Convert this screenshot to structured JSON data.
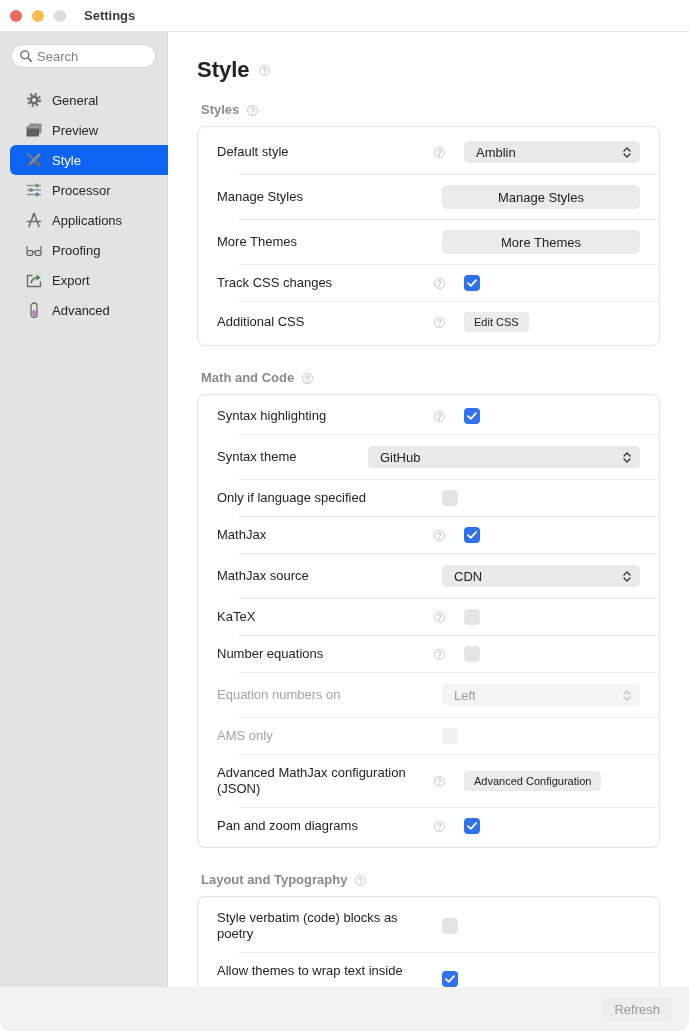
{
  "window": {
    "title": "Settings",
    "controls": [
      {
        "kind": "close",
        "disabled": false
      },
      {
        "kind": "minimize",
        "disabled": false
      },
      {
        "kind": "zoom",
        "disabled": true
      }
    ]
  },
  "sidebar": {
    "search": {
      "placeholder": "Search"
    },
    "items": [
      {
        "label": "General",
        "selected": false
      },
      {
        "label": "Preview",
        "selected": false
      },
      {
        "label": "Style",
        "selected": true
      },
      {
        "label": "Processor",
        "selected": false
      },
      {
        "label": "Applications",
        "selected": false
      },
      {
        "label": "Proofing",
        "selected": false
      },
      {
        "label": "Export",
        "selected": false
      },
      {
        "label": "Advanced",
        "selected": false
      }
    ]
  },
  "page": {
    "title": "Style",
    "help": true
  },
  "sections": [
    {
      "title": "Styles",
      "help": true,
      "rows": [
        {
          "kind": "popup",
          "label": "Default style",
          "help": true,
          "disabled": false,
          "value": "Amblin"
        },
        {
          "kind": "button",
          "label": "Manage Styles",
          "help": false,
          "disabled": false,
          "button": "Manage Styles"
        },
        {
          "kind": "button",
          "label": "More Themes",
          "help": false,
          "disabled": false,
          "button": "More Themes"
        },
        {
          "kind": "checkbox",
          "label": "Track CSS changes",
          "help": true,
          "disabled": false,
          "checked": true
        },
        {
          "kind": "minibutton",
          "label": "Additional CSS",
          "help": true,
          "disabled": false,
          "button": "Edit CSS"
        }
      ]
    },
    {
      "title": "Math and Code",
      "help": true,
      "rows": [
        {
          "kind": "checkbox",
          "label": "Syntax highlighting",
          "help": true,
          "disabled": false,
          "checked": true
        },
        {
          "kind": "popup",
          "label": "Syntax theme",
          "help": false,
          "disabled": false,
          "value": "GitHub"
        },
        {
          "kind": "checkbox",
          "label": "Only if language specified",
          "help": false,
          "disabled": false,
          "checked": false
        },
        {
          "kind": "checkbox",
          "label": "MathJax",
          "help": true,
          "disabled": false,
          "checked": true
        },
        {
          "kind": "popup",
          "label": "MathJax source",
          "help": false,
          "disabled": false,
          "value": "CDN"
        },
        {
          "kind": "checkbox",
          "label": "KaTeX",
          "help": true,
          "disabled": false,
          "checked": false
        },
        {
          "kind": "checkbox",
          "label": "Number equations",
          "help": true,
          "disabled": false,
          "checked": false
        },
        {
          "kind": "popup",
          "label": "Equation numbers on",
          "help": false,
          "disabled": true,
          "value": "Left"
        },
        {
          "kind": "checkbox",
          "label": "AMS only",
          "help": false,
          "disabled": true,
          "checked": false
        },
        {
          "kind": "minibutton",
          "label": "Advanced MathJax configuration (JSON)",
          "help": true,
          "disabled": false,
          "button": "Advanced Configuration"
        },
        {
          "kind": "checkbox",
          "label": "Pan and zoom diagrams",
          "help": true,
          "disabled": false,
          "checked": true
        }
      ]
    },
    {
      "title": "Layout and Typography",
      "help": true,
      "rows": [
        {
          "kind": "checkbox",
          "label": "Style verbatim (code) blocks as poetry",
          "help": false,
          "disabled": false,
          "checked": false
        },
        {
          "kind": "checkbox",
          "label": "Allow themes to wrap text inside",
          "help": false,
          "disabled": false,
          "checked": true
        }
      ]
    }
  ],
  "footer": {
    "button": {
      "label": "Refresh",
      "disabled": true
    }
  }
}
